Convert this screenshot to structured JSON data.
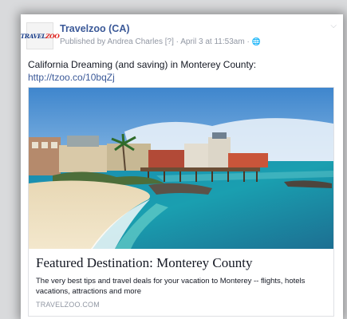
{
  "post": {
    "page_name": "Travelzoo (CA)",
    "logo": {
      "brand_a": "TRAVEL",
      "brand_b": "ZOO"
    },
    "published_by": "Published by Andrea Charles",
    "help_marker": "[?]",
    "separator": "·",
    "date": "April 3 at 11:53am",
    "audience_icon": "globe-icon",
    "menu_icon": "chevron-down-icon",
    "message": "California Dreaming (and saving) in Monterey County:",
    "link": "http://tzoo.co/10bqZj"
  },
  "attachment": {
    "image_description": "Monterey coastline photo",
    "title": "Featured Destination: Monterey County",
    "description": "The very best tips and travel deals for your vacation to Monterey -- flights, hotels vacations, attractions and more",
    "domain": "TRAVELZOO.COM"
  },
  "colors": {
    "link_blue": "#3b5998",
    "meta_gray": "#9197a3",
    "logo_blue": "#1b3f8b",
    "logo_red": "#e0201b"
  }
}
